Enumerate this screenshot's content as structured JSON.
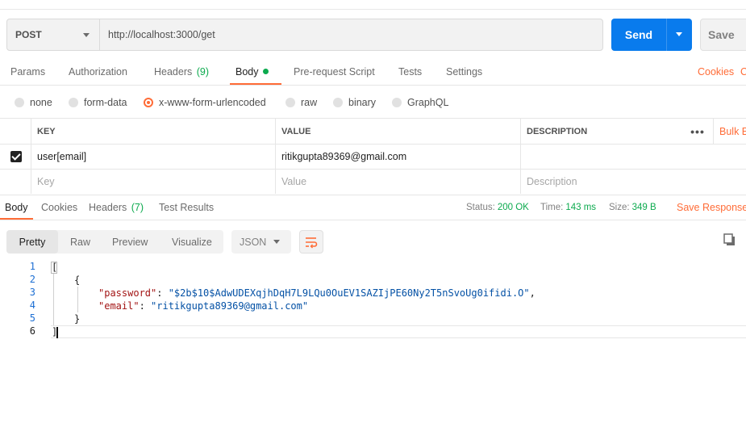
{
  "request": {
    "method": "POST",
    "url": "http://localhost:3000/get",
    "send_label": "Send",
    "save_label": "Save"
  },
  "request_tabs": [
    {
      "label": "Params"
    },
    {
      "label": "Authorization"
    },
    {
      "label": "Headers",
      "count": "(9)"
    },
    {
      "label": "Body",
      "active": true
    },
    {
      "label": "Pre-request Script"
    },
    {
      "label": "Tests"
    },
    {
      "label": "Settings"
    }
  ],
  "cookies_label": "Cookies",
  "cookies_clip": "C",
  "body_types": [
    "none",
    "form-data",
    "x-www-form-urlencoded",
    "raw",
    "binary",
    "GraphQL"
  ],
  "selected_body_type": "x-www-form-urlencoded",
  "table": {
    "headers": {
      "key": "KEY",
      "value": "VALUE",
      "description": "DESCRIPTION"
    },
    "bulk_label": "Bulk E",
    "rows": [
      {
        "checked": true,
        "key": "user[email]",
        "value": "ritikgupta89369@gmail.com",
        "description": ""
      }
    ],
    "placeholders": {
      "key": "Key",
      "value": "Value",
      "description": "Description"
    }
  },
  "response_tabs": [
    {
      "label": "Body",
      "active": true
    },
    {
      "label": "Cookies"
    },
    {
      "label": "Headers",
      "count": "(7)"
    },
    {
      "label": "Test Results"
    }
  ],
  "response_meta": {
    "status_label": "Status:",
    "status": "200 OK",
    "time_label": "Time:",
    "time": "143 ms",
    "size_label": "Size:",
    "size": "349 B",
    "save_response": "Save Response"
  },
  "view_modes": [
    "Pretty",
    "Raw",
    "Preview",
    "Visualize"
  ],
  "selected_view": "Pretty",
  "format": "JSON",
  "code": {
    "line_numbers": [
      "1",
      "2",
      "3",
      "4",
      "5",
      "6"
    ],
    "open_bracket": "[",
    "open_brace": "{",
    "password_key": "\"password\"",
    "password_value": "\"$2b$10$AdwUDEXqjhDqH7L9LQu0OuEV1SAZIjPE60Ny2T5nSvoUg0ifidi.O\"",
    "email_key": "\"email\"",
    "email_value": "\"ritikgupta89369@gmail.com\"",
    "close_brace": "}",
    "close_bracket": "]"
  },
  "colors": {
    "accent": "#ff6c37",
    "primary": "#097bed",
    "success": "#0caa4e"
  }
}
